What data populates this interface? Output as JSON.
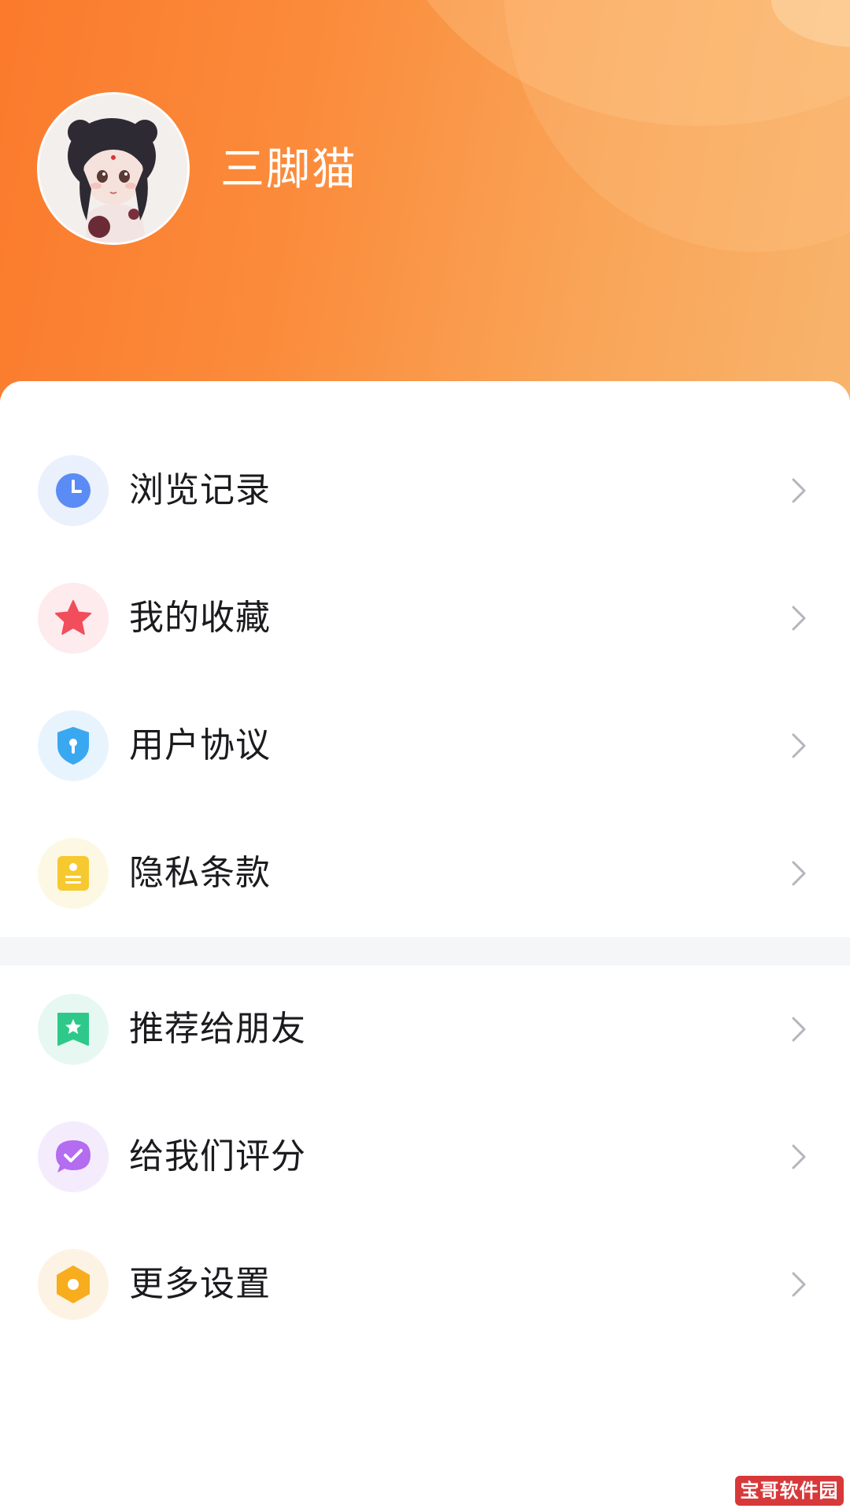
{
  "profile": {
    "username": "三脚猫",
    "avatar": "doll-avatar"
  },
  "menu_group_1": [
    {
      "label": "浏览记录",
      "icon": "clock-icon",
      "icon_color": "#5b8cf5",
      "bg_color": "#eaf0fc"
    },
    {
      "label": "我的收藏",
      "icon": "star-icon",
      "icon_color": "#f24d5a",
      "bg_color": "#fdebee"
    },
    {
      "label": "用户协议",
      "icon": "shield-icon",
      "icon_color": "#3aa8f0",
      "bg_color": "#e8f4fd"
    },
    {
      "label": "隐私条款",
      "icon": "document-icon",
      "icon_color": "#f7c930",
      "bg_color": "#fdf8e4"
    }
  ],
  "menu_group_2": [
    {
      "label": "推荐给朋友",
      "icon": "bookmark-star-icon",
      "icon_color": "#2ec98a",
      "bg_color": "#e6f8f1"
    },
    {
      "label": "给我们评分",
      "icon": "chat-check-icon",
      "icon_color": "#b46cf0",
      "bg_color": "#f4ecfd"
    },
    {
      "label": "更多设置",
      "icon": "hexagon-settings-icon",
      "icon_color": "#f7ad1e",
      "bg_color": "#fdf3e4"
    }
  ],
  "watermark": "宝哥软件园"
}
